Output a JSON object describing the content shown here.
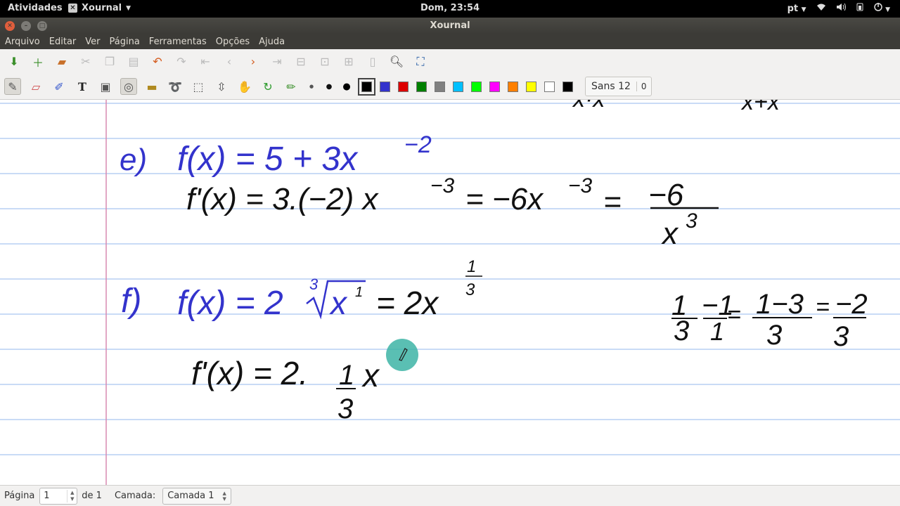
{
  "topbar": {
    "activities": "Atividades",
    "app_name": "Xournal",
    "clock": "Dom, 23:54",
    "language": "pt"
  },
  "window": {
    "title": "Xournal"
  },
  "menu": [
    "Arquivo",
    "Editar",
    "Ver",
    "Página",
    "Ferramentas",
    "Opções",
    "Ajuda"
  ],
  "toolbar": {
    "font_name": "Sans 12",
    "font_extra": "0",
    "colors": [
      "#000000",
      "#3333cc",
      "#dd0000",
      "#008000",
      "#808080",
      "#00c0ff",
      "#00ff00",
      "#ff00ff",
      "#ff8000",
      "#ffff00",
      "#ffffff",
      "#000000"
    ]
  },
  "handwriting": {
    "e_label": "e)",
    "e_func": "f(x) = 5 + 3x",
    "e_exp": "−2",
    "e_deriv": "f'(x) = 3.(−2) x",
    "e_deriv_exp": "−3",
    "e_eq": "= −6x",
    "e_eq_exp": "−3",
    "e_frac_eq": "=",
    "e_num": "−6",
    "e_den": "x",
    "e_den_exp": "3",
    "f_label": "f)",
    "f_func": "f(x) = 2",
    "f_root_index": "3",
    "f_radicand": "x",
    "f_radicand_exp": "1",
    "f_eq": "= 2x",
    "f_exp_num": "1",
    "f_exp_den": "3",
    "f_deriv": "f'(x) = 2.",
    "f_deriv_num": "1",
    "f_deriv_den": "3",
    "f_deriv_x": "x",
    "side_a_num": "1",
    "side_a_den": "3",
    "side_b_num": "−1",
    "side_b_den": "1",
    "side_c_num": "1−3",
    "side_c_den": "3",
    "side_eq1": "=",
    "side_eq2": "=",
    "side_d_num": "−2",
    "side_d_den": "3"
  },
  "statusbar": {
    "page_label": "Página",
    "page_value": "1",
    "page_of": "de 1",
    "layer_label": "Camada:",
    "layer_value": "Camada 1"
  }
}
